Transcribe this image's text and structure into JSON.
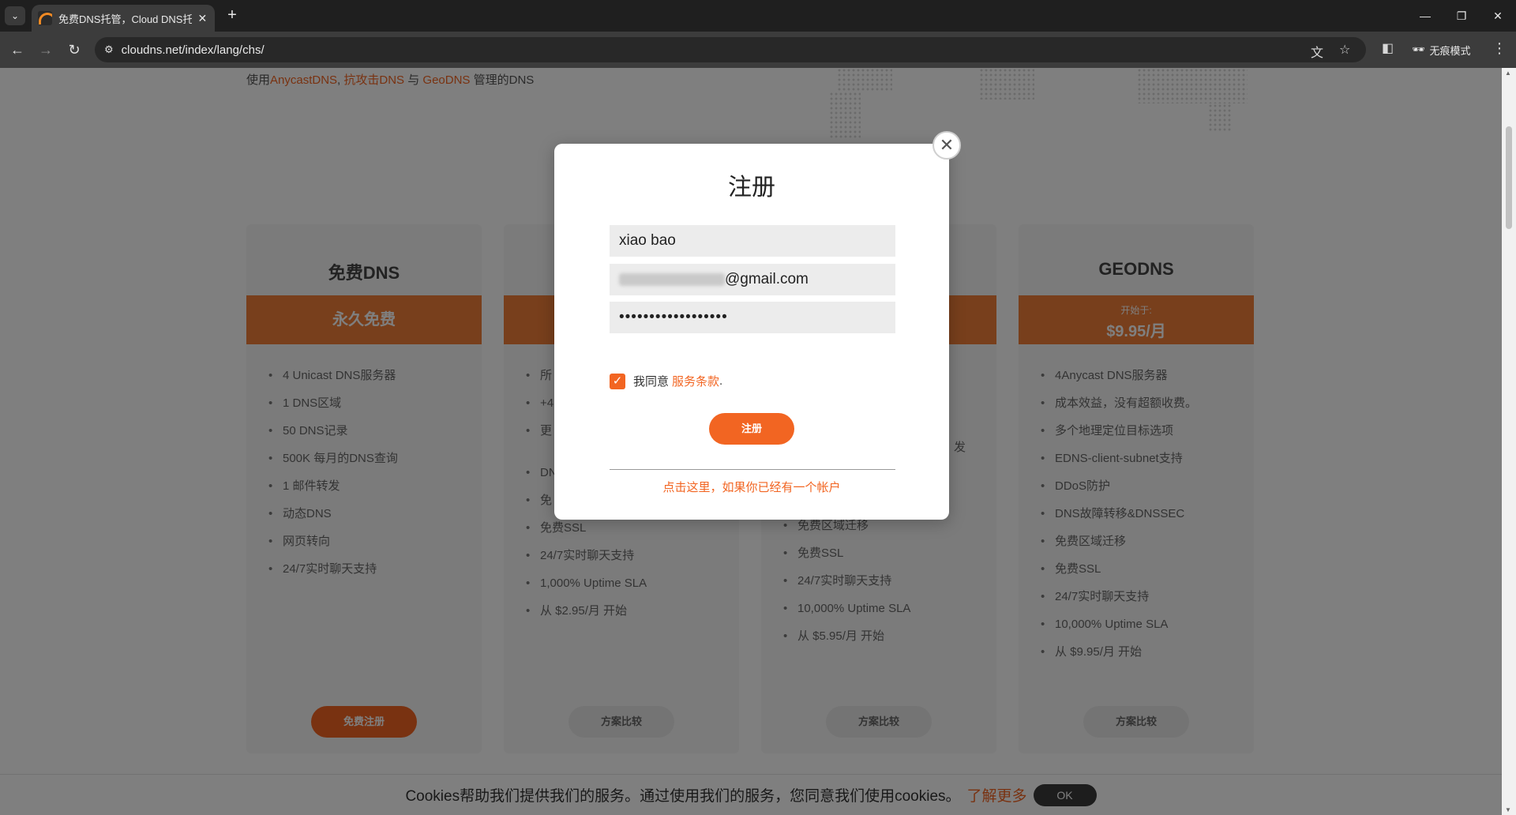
{
  "browser": {
    "tab_title": "免费DNS托管，Cloud DNS托管",
    "url": "cloudns.net/index/lang/chs/",
    "incognito_label": "无痕模式"
  },
  "page": {
    "intro": {
      "prefix": "使用",
      "link1": "AnycastDNS",
      "sep1": ", ",
      "link2": "抗攻击DNS",
      "sep2": " 与 ",
      "link3": "GeoDNS",
      "suffix": " 管理的DNS"
    },
    "plans": [
      {
        "title": "免费DNS",
        "banner": "永久免费",
        "features": [
          "4 Unicast DNS服务器",
          "1 DNS区域",
          "50 DNS记录",
          "500K 每月的DNS查询",
          "1 邮件转发",
          "动态DNS",
          "网页转向",
          "24/7实时聊天支持"
        ],
        "button": "免费注册"
      },
      {
        "title": "",
        "banner": "",
        "features": [
          "所",
          "+4",
          "更",
          "DN",
          "免",
          "免费SSL",
          "24/7实时聊天支持",
          "1,000% Uptime SLA",
          "从 $2.95/月 开始"
        ],
        "button": "方案比较"
      },
      {
        "title": "",
        "banner": "",
        "features": [
          "",
          "",
          "",
          "",
          "免费区域迁移",
          "免费SSL",
          "24/7实时聊天支持",
          "10,000% Uptime SLA",
          "从 $5.95/月 开始"
        ],
        "partial_right": "发",
        "button": "方案比较"
      },
      {
        "title": "GEODNS",
        "banner_small": "开始于:",
        "banner_price": "$9.95/月",
        "features": [
          "4Anycast DNS服务器",
          "成本效益，没有超额收费。",
          "多个地理定位目标选项",
          "EDNS-client-subnet支持",
          "DDoS防护",
          "DNS故障转移&DNSSEC",
          "免费区域迁移",
          "免费SSL",
          "24/7实时聊天支持",
          "10,000% Uptime SLA",
          "从 $9.95/月 开始"
        ],
        "button": "方案比较"
      }
    ],
    "cookie": {
      "text": "Cookies帮助我们提供我们的服务。通过使用我们的服务，您同意我们使用cookies。",
      "link": "了解更多",
      "ok": "OK"
    }
  },
  "modal": {
    "title": "注册",
    "name_value": "xiao bao",
    "email_suffix": "@gmail.com",
    "password_mask": "••••••••••••••••••",
    "agree_text": "我同意",
    "terms_link": "服务条款",
    "terms_period": ".",
    "submit": "注册",
    "login_link": "点击这里，如果你已经有一个帐户"
  },
  "colors": {
    "accent": "#f26522",
    "banner": "#f07e38"
  }
}
